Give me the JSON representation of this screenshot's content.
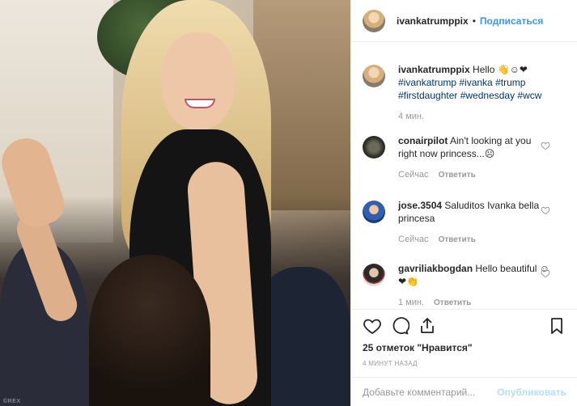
{
  "photo": {
    "description_alt": "",
    "credit": "©REX"
  },
  "header": {
    "username": "ivankatrumppix",
    "separator": "•",
    "follow_label": "Подписаться"
  },
  "caption": {
    "username": "ivankatrumppix",
    "text": "Hello 👋☺❤",
    "hashtags": "#ivankatrump #ivanka #trump #firstdaughter #wednesday #wcw",
    "time": "4 мин."
  },
  "comments": [
    {
      "username": "conairpilot",
      "text": "Ain't looking at you right now princess...☹",
      "time": "Сейчас",
      "reply": "Ответить"
    },
    {
      "username": "jose.3504",
      "text": "Saluditos Ivanka bella princesa",
      "time": "Сейчас",
      "reply": "Ответить"
    },
    {
      "username": "gavriliakbogdan",
      "text": "Hello beautiful ☺❤👏",
      "time": "1 мин.",
      "reply": "Ответить"
    }
  ],
  "actions": {
    "likes": "25 отметок \"Нравится\"",
    "posted": "4 минут назад"
  },
  "add_comment": {
    "placeholder": "Добавьте комментарий...",
    "publish_label": "Опубликовать"
  },
  "colors": {
    "link": "#3897f0",
    "hashtag": "#003569",
    "muted": "#999999",
    "publish_disabled": "#b2dffc"
  }
}
